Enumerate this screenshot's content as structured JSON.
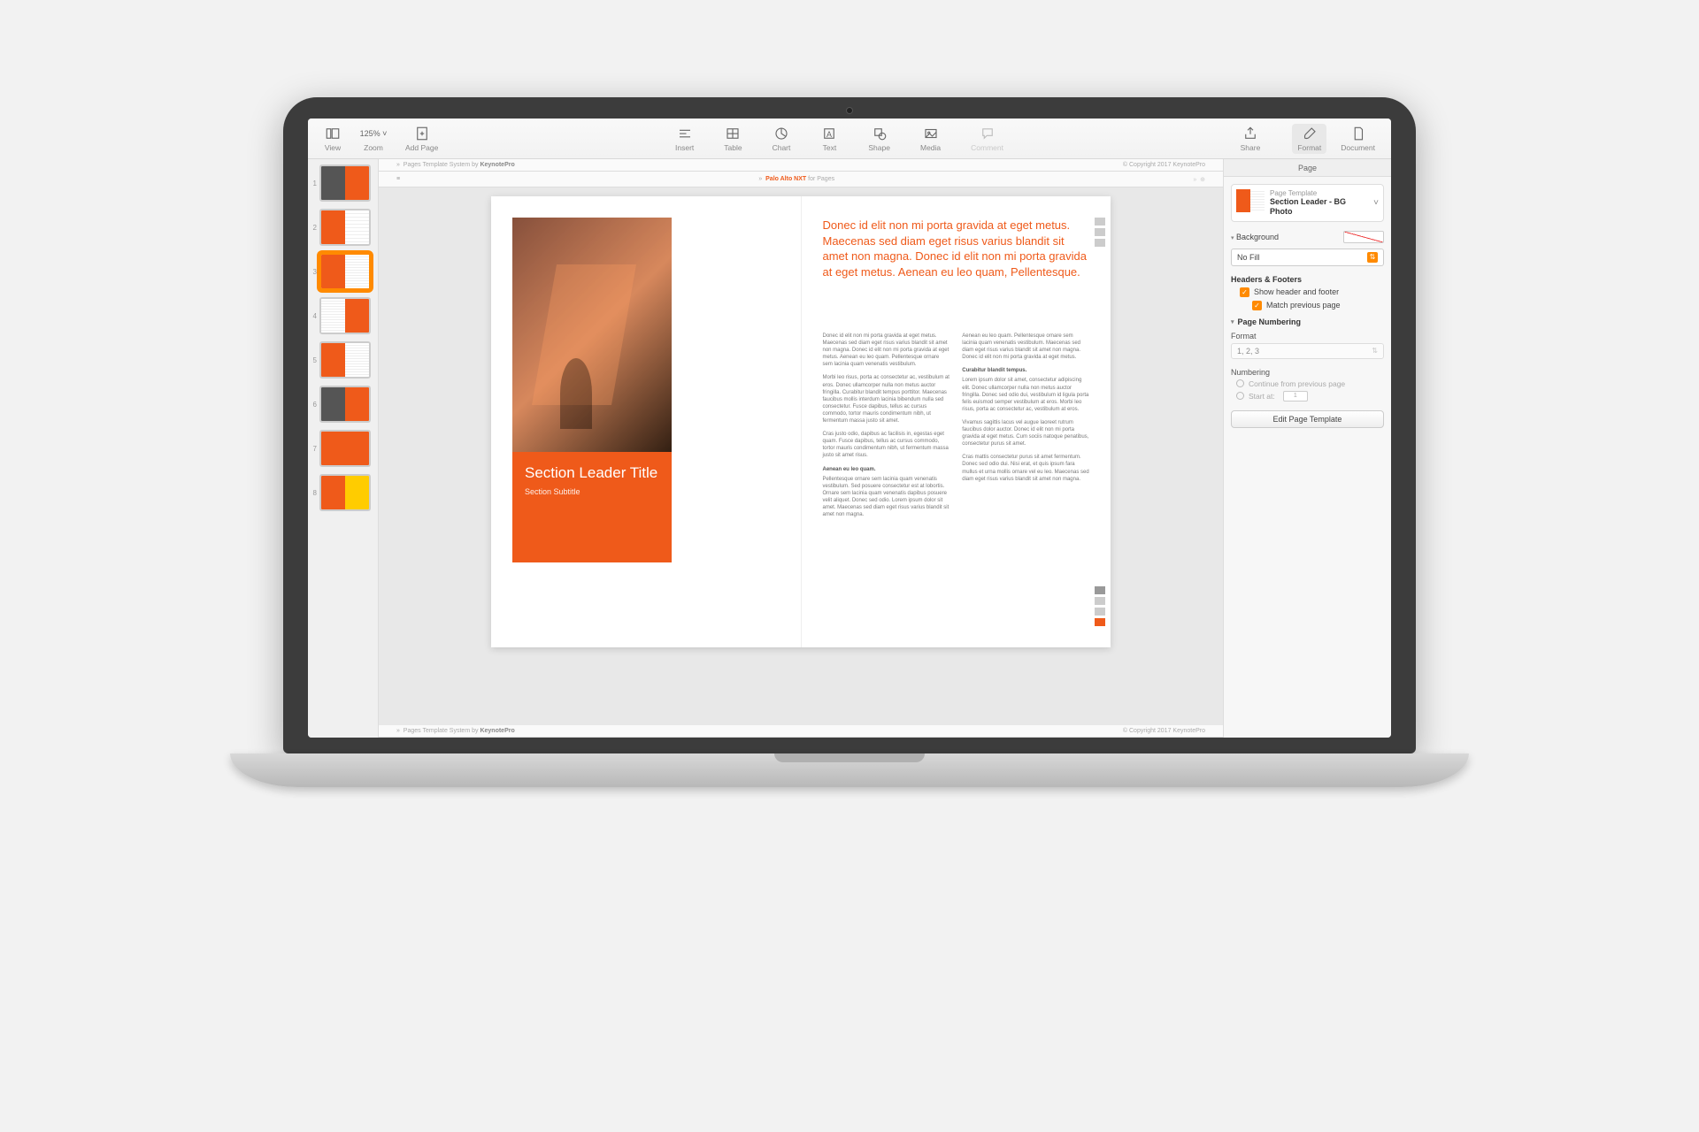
{
  "toolbar": {
    "view": "View",
    "zoom": "Zoom",
    "zoom_value": "125%",
    "add_page": "Add Page",
    "insert": "Insert",
    "table": "Table",
    "chart": "Chart",
    "text": "Text",
    "shape": "Shape",
    "media": "Media",
    "comment": "Comment",
    "share": "Share",
    "format": "Format",
    "document": "Document"
  },
  "header_strip": {
    "prefix": "Pages Template System by",
    "brand": "KeynotePro",
    "copyright": "© Copyright 2017 KeynotePro"
  },
  "title_strip": {
    "product": "Palo Alto NXT",
    "for": "for Pages"
  },
  "thumbnails": [
    "1",
    "2",
    "3",
    "4",
    "5",
    "6",
    "7",
    "8"
  ],
  "selected_thumb": 3,
  "document": {
    "lead": "Donec id elit non mi porta gravida at eget metus. Maecenas sed diam eget risus varius blandit sit amet non magna. Donec id elit non mi porta gravida at eget metus. Aenean eu leo quam, Pellentesque.",
    "col1": {
      "p1": "Donec id elit non mi porta gravida at eget metus. Maecenas sed diam eget risus varius blandit sit amet non magna. Donec id elit non mi porta gravida at eget metus. Aenean eu leo quam. Pellentesque ornare sem lacinia quam venenatis vestibulum.",
      "p2": "Morbi leo risus, porta ac consectetur ac, vestibulum at eros. Donec ullamcorper nulla non metus auctor fringilla. Curabitur blandit tempus porttitor. Maecenas faucibus mollis interdum lacinia bibendum nulla sed consectetur. Fusce dapibus, tellus ac cursus commodo, tortor mauris condimentum nibh, ut fermentum massa justo sit amet.",
      "p3": "Cras justo odio, dapibus ac facilisis in, egestas eget quam. Fusce dapibus, tellus ac cursus commodo, tortor mauris condimentum nibh, ut fermentum massa justo sit amet risus.",
      "h1": "Aenean eu leo quam.",
      "p4": "Pellentesque ornare sem lacinia quam venenatis vestibulum. Sed posuere consectetur est at lobortis. Ornare sem lacinia quam venenatis dapibus posuere velit aliquet. Donec sed odio. Lorem ipsum dolor sit amet. Maecenas sed diam eget risus varius blandit sit amet non magna."
    },
    "col2": {
      "p1": "Aenean eu leo quam. Pellentesque ornare sem lacinia quam venenatis vestibulum. Maecenas sed diam eget risus varius blandit sit amet non magna. Donec id elit non mi porta gravida at eget metus.",
      "h1": "Curabitur blandit tempus.",
      "p2": "Lorem ipsum dolor sit amet, consectetur adipiscing elit. Donec ullamcorper nulla non metus auctor fringilla. Donec sed odio dui, vestibulum id ligula porta felis euismod semper vestibulum at eros. Morbi leo risus, porta ac consectetur ac, vestibulum at eros.",
      "p3": "Vivamus sagittis lacus vel augue laoreet rutrum faucibus dolor auctor. Donec id elit non mi porta gravida at eget metus. Cum sociis natoque penatibus, consectetur purus sit amet.",
      "p4": "Cras mattis consectetur purus sit amet fermentum. Donec sed odio dui. Nisi erat, et quis ipsum fara mullus et urna mollis ornare vel eu leo. Maecenas sed diam eget risus varius blandit sit amet non magna."
    },
    "hero": {
      "title": "Section Leader Title",
      "subtitle": "Section Subtitle"
    }
  },
  "footer_strip": {
    "prefix": "Pages Template System by",
    "brand": "KeynotePro",
    "copyright": "© Copyright 2017 KeynotePro"
  },
  "inspector": {
    "tab": "Page",
    "template_label": "Page Template",
    "template_value": "Section Leader - BG Photo",
    "background_label": "Background",
    "fill_value": "No Fill",
    "headers_section": "Headers & Footers",
    "show_hf": "Show header and footer",
    "match_prev": "Match previous page",
    "numbering_section": "Page Numbering",
    "format_label": "Format",
    "format_value": "1, 2, 3",
    "numbering_label": "Numbering",
    "continue": "Continue from previous page",
    "start_at": "Start at:",
    "start_value": "1",
    "edit_button": "Edit Page Template"
  }
}
